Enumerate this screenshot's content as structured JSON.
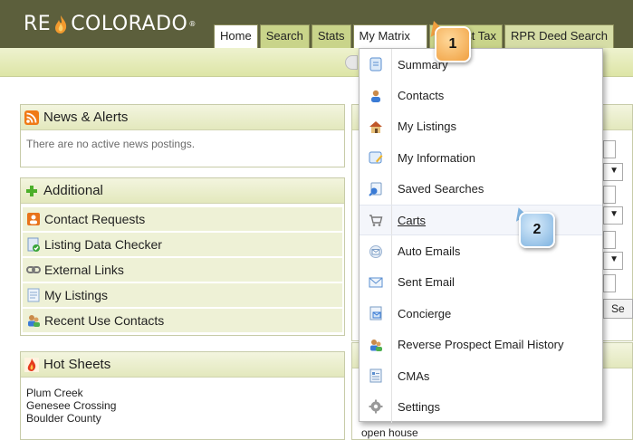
{
  "header": {
    "logo_text_left": "RE",
    "logo_text_right": "COLORADO",
    "logo_mark": "®",
    "tabs": [
      {
        "label": "Home"
      },
      {
        "label": "Search"
      },
      {
        "label": "Stats"
      },
      {
        "label": "My Matrix"
      },
      {
        "label": "list Tax"
      },
      {
        "label": "RPR Deed Search"
      }
    ]
  },
  "news": {
    "title": "News & Alerts",
    "icon": "rss-icon",
    "empty_text": "There are no active news postings."
  },
  "additional": {
    "title": "Additional",
    "items": [
      {
        "label": "Contact Requests",
        "icon": "contact-request-icon"
      },
      {
        "label": "Listing Data Checker",
        "icon": "data-checker-icon"
      },
      {
        "label": "External Links",
        "icon": "link-icon"
      },
      {
        "label": "My Listings",
        "icon": "listing-icon"
      },
      {
        "label": "Recent Use Contacts",
        "icon": "contacts-icon"
      }
    ]
  },
  "hotsheets": {
    "title": "Hot Sheets",
    "items": [
      "Plum Creek",
      "Genesee Crossing",
      "Boulder County"
    ]
  },
  "bottom_right": {
    "fragment1": "open house"
  },
  "right_fragments": {
    "se": "Se"
  },
  "menu": {
    "items": [
      {
        "label": "Summary",
        "icon": "summary-icon"
      },
      {
        "label": "Contacts",
        "icon": "contact-icon"
      },
      {
        "label": "My Listings",
        "icon": "house-icon"
      },
      {
        "label": "My Information",
        "icon": "info-icon"
      },
      {
        "label": "Saved Searches",
        "icon": "saved-search-icon"
      },
      {
        "label": "Carts",
        "icon": "cart-icon"
      },
      {
        "label": "Auto Emails",
        "icon": "auto-email-icon"
      },
      {
        "label": "Sent Email",
        "icon": "envelope-icon"
      },
      {
        "label": "Concierge",
        "icon": "concierge-icon"
      },
      {
        "label": "Reverse Prospect Email History",
        "icon": "prospect-icon"
      },
      {
        "label": "CMAs",
        "icon": "cma-icon"
      },
      {
        "label": "Settings",
        "icon": "gear-icon"
      }
    ]
  },
  "callouts": {
    "first": "1",
    "second": "2"
  },
  "colors": {
    "header_bg": "#5c5f3c",
    "tab_green": "#c9d48a",
    "callout_orange": "#f0a040",
    "callout_blue": "#7fb3e0"
  }
}
